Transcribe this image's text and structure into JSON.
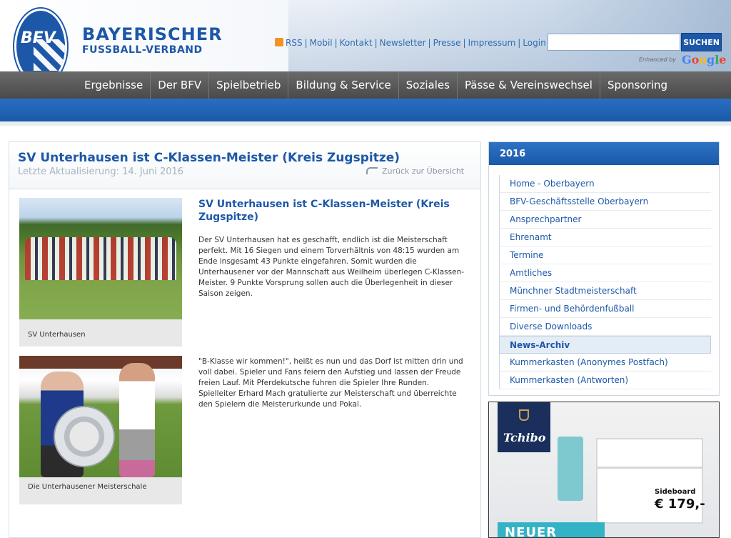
{
  "header": {
    "logo_text": "BFV",
    "brand_line1": "BAYERISCHER",
    "brand_line2": "FUSSBALL-VERBAND",
    "links": [
      "RSS",
      "Mobil",
      "Kontakt",
      "Newsletter",
      "Presse",
      "Impressum",
      "Login"
    ],
    "search": {
      "placeholder": "",
      "button": "SUCHEN",
      "enhanced": "Enhanced by",
      "google": "Google"
    }
  },
  "nav": [
    "Ergebnisse",
    "Der BFV",
    "Spielbetrieb",
    "Bildung & Service",
    "Soziales",
    "Pässe & Vereinswechsel",
    "Sponsoring"
  ],
  "article": {
    "title": "SV Unterhausen ist C-Klassen-Meister (Kreis Zugspitze)",
    "updated": "Letzte Aktualisierung: 14. Juni 2016",
    "back": "Zurück zur Übersicht",
    "subtitle": "SV Unterhausen ist C-Klassen-Meister (Kreis Zugspitze)",
    "paragraph1": "Der SV Unterhausen hat es geschafft, endlich ist die Meisterschaft perfekt. Mit 16 Siegen und einem Torverhältnis von 48:15 wurden am Ende insgesamt 43 Punkte eingefahren. Somit wurden die Unterhausener vor der Mannschaft aus Weilheim überlegen C-Klassen-Meister. 9 Punkte Vorsprung sollen auch die Überlegenheit in dieser Saison zeigen.",
    "paragraph2": "\"B-Klasse wir kommen!\", heißt es nun und das Dorf ist mitten drin und voll dabei. Spieler und Fans feiern den Aufstieg und lassen der Freude freien Lauf. Mit Pferdekutsche fuhren die Spieler Ihre Runden. Spielleiter Erhard Mach gratulierte zur Meisterschaft und überreichte den Spielern die Meisterurkunde und Pokal.",
    "photo1_caption": "SV Unterhausen",
    "photo2_caption": "Die Unterhausener Meisterschale"
  },
  "sidebar": {
    "year": "2016",
    "items": [
      {
        "label": "Home - Oberbayern"
      },
      {
        "label": "BFV-Geschäftsstelle Oberbayern"
      },
      {
        "label": "Ansprechpartner"
      },
      {
        "label": "Ehrenamt"
      },
      {
        "label": "Termine"
      },
      {
        "label": "Amtliches"
      },
      {
        "label": "Münchner Stadtmeisterschaft"
      },
      {
        "label": "Firmen- und Behördenfußball"
      },
      {
        "label": "Diverse Downloads"
      },
      {
        "label": "News-Archiv",
        "active": true
      },
      {
        "label": "Kummerkasten (Anonymes Postfach)"
      },
      {
        "label": "Kummerkasten (Antworten)"
      }
    ]
  },
  "ad": {
    "brand": "Tchibo",
    "product": "Sideboard",
    "price": "€ 179,-",
    "banner": "NEUER LOOK"
  },
  "colors": {
    "brand_blue": "#1d58a8",
    "nav_grey": "#555555",
    "link_blue": "#2e6db2"
  }
}
